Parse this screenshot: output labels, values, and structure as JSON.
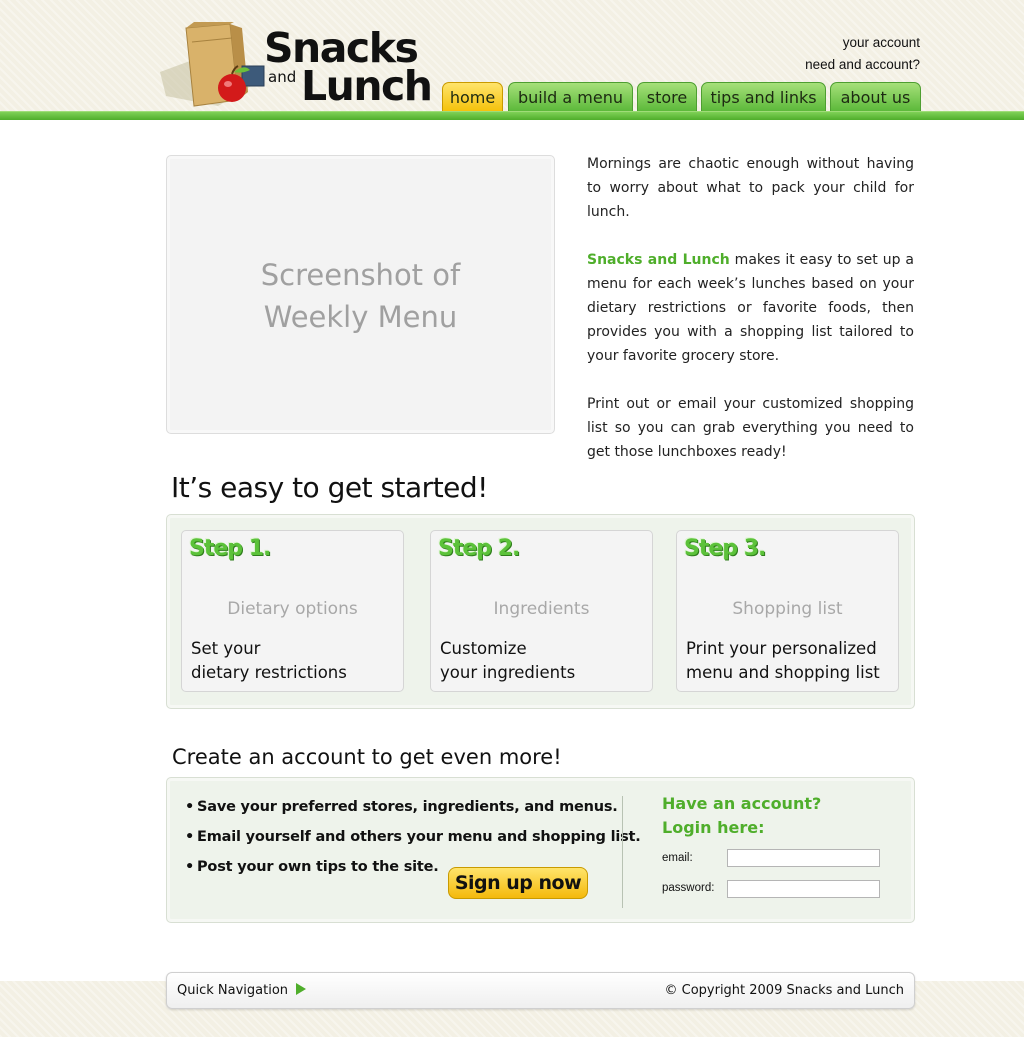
{
  "logo": {
    "line1": "Snacks",
    "connector": "and",
    "line2": "Lunch",
    "icon": "lunch-bag-apple-icon"
  },
  "account_links": [
    "your account",
    "need and account?"
  ],
  "nav": [
    {
      "label": "home",
      "active": true
    },
    {
      "label": "build a menu",
      "active": false
    },
    {
      "label": "store",
      "active": false
    },
    {
      "label": "tips and links",
      "active": false
    },
    {
      "label": "about us",
      "active": false
    }
  ],
  "placeholder": {
    "line1": "Screenshot of",
    "line2": "Weekly Menu"
  },
  "intro": {
    "p1": "Mornings are chaotic enough without having to worry about what to pack your child for lunch.",
    "p2_brand": "Snacks and Lunch",
    "p2_rest": " makes it easy to set up a menu for each week’s lunches based on your dietary restrictions or favorite foods, then provides you with a shopping list tailored to your favorite grocery store.",
    "p3": "Print out or email your customized shopping list so you can grab everything you need to get those lunchboxes ready!"
  },
  "steps_heading": "It’s easy to get started!",
  "steps": [
    {
      "title": "Step 1.",
      "name": "Dietary options",
      "desc_line1": "Set your",
      "desc_line2": "dietary restrictions"
    },
    {
      "title": "Step 2.",
      "name": "Ingredients",
      "desc_line1": "Customize",
      "desc_line2": "your ingredients"
    },
    {
      "title": "Step 3.",
      "name": "Shopping list",
      "desc_line1": "Print your personalized",
      "desc_line2": "menu and shopping list"
    }
  ],
  "account_heading": "Create an account to get even more!",
  "benefits": [
    "Save your preferred stores, ingredients, and menus.",
    "Email yourself and others your menu and shopping list.",
    "Post your own tips to the site."
  ],
  "signup_label": "Sign up now",
  "login": {
    "heading_line1": "Have an account?",
    "heading_line2": "Login here:",
    "email_label": "email:",
    "email_value": "",
    "password_label": "password:",
    "password_value": ""
  },
  "footer": {
    "quick_nav": "Quick Navigation",
    "copyright": "© Copyright 2009 Snacks and Lunch"
  },
  "colors": {
    "brand_green": "#4fae2b",
    "active_tab": "#f5c20c",
    "panel_bg": "#eef3eb"
  }
}
